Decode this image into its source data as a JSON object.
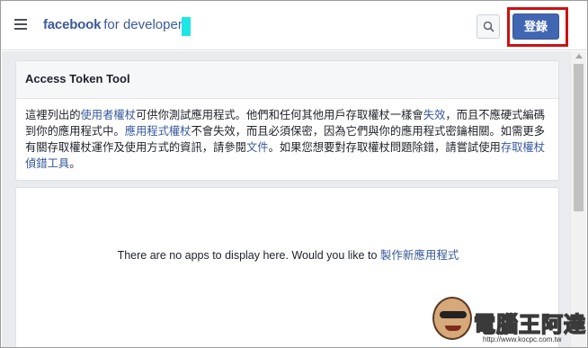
{
  "header": {
    "brand_name": "facebook",
    "brand_suffix": "for developers",
    "login_label": "登錄",
    "menu_icon": "hamburger-icon",
    "search_icon": "search-icon"
  },
  "access_token_card": {
    "title": "Access Token Tool",
    "p1": "這裡列出的",
    "link_user_token": "使用者權杖",
    "p2": "可供你測試應用程式。他們和任何其他用戶存取權杖一樣會",
    "link_expire": "失效",
    "p3": "，而且不應硬式編碼到你的應用程式中。",
    "link_app_token": "應用程式權杖",
    "p4": "不會失效，而且必須保密，因為它們與你的應用程式密鑰相關。如需更多有關存取權杖運作及使用方式的資訊，請參閱",
    "link_docs": "文件",
    "p5": "。如果您想要對存取權杖問題除錯，請嘗試使用",
    "link_debugger": "存取權杖偵錯工具",
    "p6": "。"
  },
  "apps_card": {
    "message": "There are no apps to display here. Would you like to",
    "create_link": "製作新應用程式"
  },
  "watermark": {
    "text": "電腦王阿達",
    "url": "http://www.kocpc.com.tw"
  },
  "colors": {
    "brand": "#3b5998",
    "login_button": "#4267b2",
    "highlight_border": "#cc1111",
    "background": "#e9ebee"
  }
}
